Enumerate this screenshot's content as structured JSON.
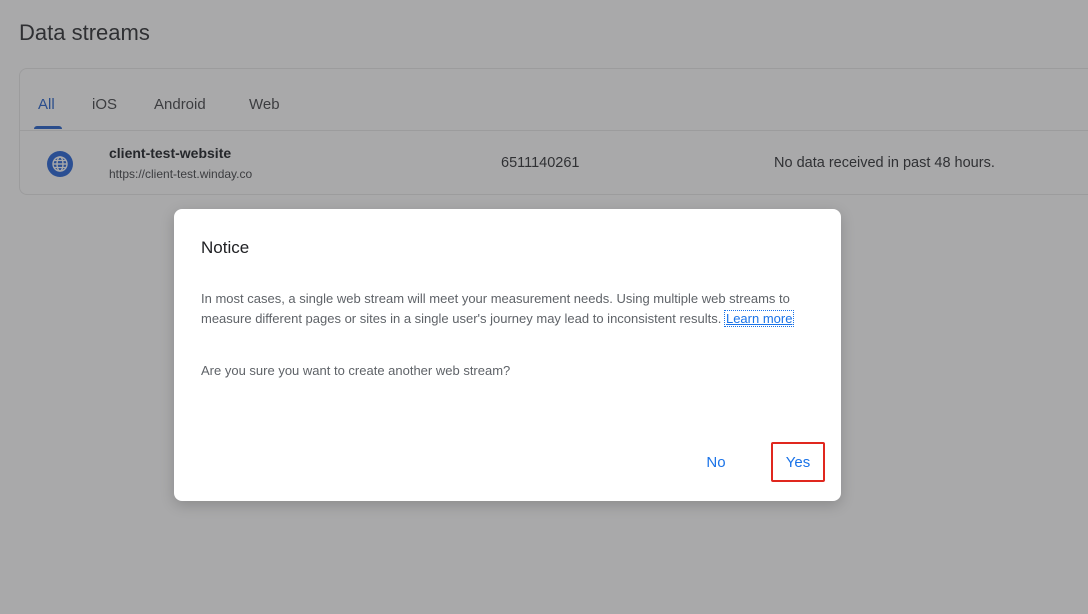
{
  "page": {
    "title": "Data streams"
  },
  "tabs": [
    {
      "label": "All",
      "active": true
    },
    {
      "label": "iOS",
      "active": false
    },
    {
      "label": "Android",
      "active": false
    },
    {
      "label": "Web",
      "active": false
    }
  ],
  "stream": {
    "icon": "globe-icon",
    "name": "client-test-website",
    "url": "https://client-test.winday.co",
    "id": "6511140261",
    "status": "No data received in past 48 hours."
  },
  "dialog": {
    "title": "Notice",
    "body": "In most cases, a single web stream will meet your measurement needs. Using multiple web streams to measure different pages or sites in a single user's journey may lead to inconsistent results.",
    "link": "Learn more",
    "question": "Are you sure you want to create another web stream?",
    "no_label": "No",
    "yes_label": "Yes"
  },
  "colors": {
    "overlay": "#a9a9aa",
    "accent": "#1a73e8",
    "highlight": "#e0271e"
  }
}
